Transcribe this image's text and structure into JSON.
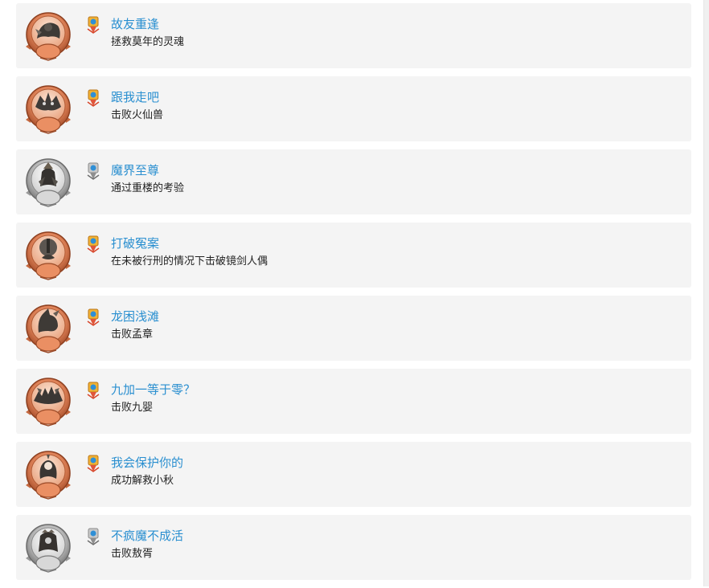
{
  "achievements": [
    {
      "title": "故友重逢",
      "description": "拯救莫年的灵魂",
      "tier": "bronze",
      "icon": "warrior-portrait-icon"
    },
    {
      "title": "跟我走吧",
      "description": "击败火仙兽",
      "tier": "bronze",
      "icon": "beast-portrait-icon"
    },
    {
      "title": "魔界至尊",
      "description": "通过重楼的考验",
      "tier": "silver",
      "icon": "demon-lord-portrait-icon"
    },
    {
      "title": "打破冤案",
      "description": "在未被行刑的情况下击破镜剑人偶",
      "tier": "bronze",
      "icon": "mirror-puppet-portrait-icon"
    },
    {
      "title": "龙困浅滩",
      "description": "击败孟章",
      "tier": "bronze",
      "icon": "dragon-portrait-icon"
    },
    {
      "title": "九加一等于零？",
      "description": "击败九婴",
      "tier": "bronze",
      "icon": "nine-headed-beast-portrait-icon"
    },
    {
      "title": "我会保护你的",
      "description": "成功解救小秋",
      "tier": "bronze",
      "icon": "girl-portrait-icon"
    },
    {
      "title": "不疯魔不成活",
      "description": "击败敖胥",
      "tier": "silver",
      "icon": "dragon-king-portrait-icon"
    }
  ],
  "colors": {
    "card_background": "#f4f4f4",
    "title": "#2a8fd0",
    "description": "#222222",
    "bronze_medal": "#e0845a",
    "silver_medal": "#b8b8b8"
  }
}
